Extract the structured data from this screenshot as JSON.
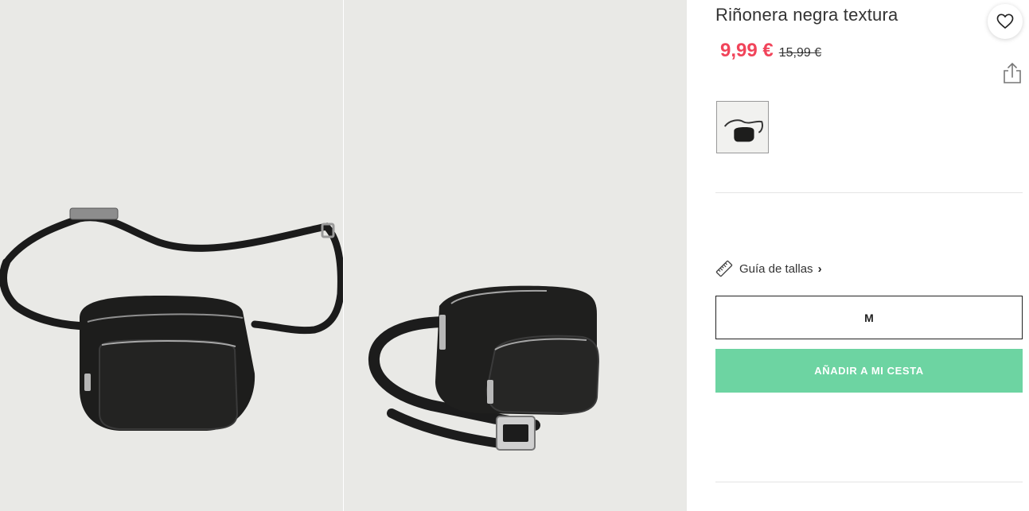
{
  "product": {
    "title": "Riñonera negra textura",
    "price_now": "9,99 €",
    "price_old": "15,99 €",
    "images": [
      "product-photo-front",
      "product-photo-side"
    ]
  },
  "actions": {
    "favorite_icon": "heart-icon",
    "share_icon": "share-icon"
  },
  "color_swatches": [
    {
      "icon": "bag-thumbnail",
      "selected": true
    }
  ],
  "size_guide": {
    "icon": "ruler-icon",
    "label": "Guía de tallas",
    "chevron": "›"
  },
  "size": {
    "selected": "M"
  },
  "cart": {
    "add_label": "AÑADIR A MI CESTA"
  },
  "colors": {
    "price_sale": "#f1445a",
    "add_button": "#6dd4a2",
    "photo_bg": "#e9e9e6"
  }
}
